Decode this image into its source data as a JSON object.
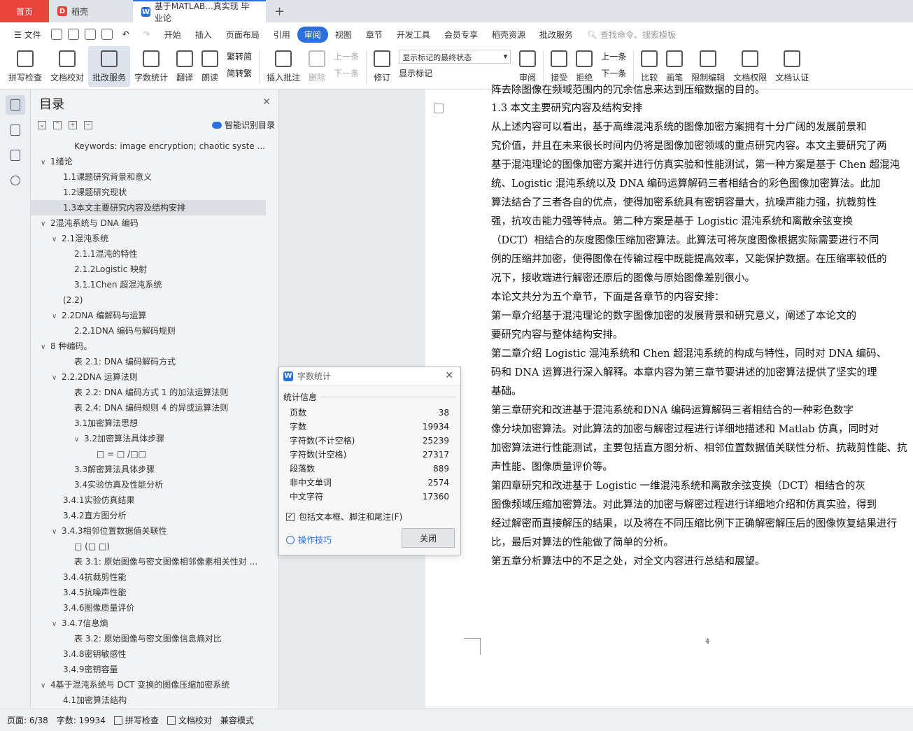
{
  "tabs": {
    "home": "首页",
    "daoke": "稻壳",
    "doc": "基于MATLAB...真实现 毕业论",
    "plus": "+"
  },
  "menu": [
    "文件",
    "开始",
    "插入",
    "页面布局",
    "引用",
    "审阅",
    "视图",
    "章节",
    "开发工具",
    "会员专享",
    "稻壳资源",
    "批改服务"
  ],
  "menu_active": "审阅",
  "search_placeholder": "查找命令、搜索模板",
  "ribbon": {
    "spell": "拼写检查",
    "doccheck": "文档校对",
    "correct": "批改服务",
    "wordcount": "字数统计",
    "translate": "翻译",
    "read": "朗读",
    "trad": "繁转简",
    "simp": "简转繁",
    "insert_comment": "插入批注",
    "delete": "删除",
    "prev": "上一条",
    "next": "下一条",
    "track": "修订",
    "show_final": "显示标记的最终状态",
    "show_marks": "显示标记",
    "review": "审阅",
    "accept": "接受",
    "reject": "拒绝",
    "prev2": "上一条",
    "next2": "下一条",
    "compare": "比较",
    "pen": "画笔",
    "restrict": "限制编辑",
    "perm": "文档权限",
    "cert": "文档认证"
  },
  "toc": {
    "title": "目录",
    "smart": "智能识别目录",
    "items": [
      {
        "t": "Keywords: image encryption; chaotic syste ...",
        "l": 3,
        "c": ""
      },
      {
        "t": "1绪论",
        "l": 1,
        "c": "v"
      },
      {
        "t": "1.1课题研究背景和意义",
        "l": 2,
        "c": ""
      },
      {
        "t": "1.2课题研究现状",
        "l": 2,
        "c": ""
      },
      {
        "t": "1.3本文主要研究内容及结构安排",
        "l": 2,
        "c": "",
        "sel": true
      },
      {
        "t": "2混沌系统与 DNA 编码",
        "l": 1,
        "c": "v"
      },
      {
        "t": "2.1混沌系统",
        "l": 2,
        "c": "v"
      },
      {
        "t": "2.1.1混沌的特性",
        "l": 3,
        "c": ""
      },
      {
        "t": "2.1.2Logistic 映射",
        "l": 3,
        "c": ""
      },
      {
        "t": "3.1.1Chen 超混沌系统",
        "l": 3,
        "c": ""
      },
      {
        "t": "(2.2)",
        "l": 2,
        "c": ""
      },
      {
        "t": "2.2DNA 编解码与运算",
        "l": 2,
        "c": "v"
      },
      {
        "t": "2.2.1DNA 编码与解码规则",
        "l": 3,
        "c": ""
      },
      {
        "t": "8 种编码。",
        "l": 1,
        "c": "v"
      },
      {
        "t": "表 2.1:  DNA 编码解码方式",
        "l": 3,
        "c": ""
      },
      {
        "t": "2.2.2DNA 运算法则",
        "l": 2,
        "c": "v"
      },
      {
        "t": "表 2.2:  DNA 编码方式 1 的加法运算法则",
        "l": 3,
        "c": ""
      },
      {
        "t": "表 2.4:  DNA 编码规则 4 的异或运算法则",
        "l": 3,
        "c": ""
      },
      {
        "t": "3.1加密算法思想",
        "l": 3,
        "c": ""
      },
      {
        "t": "3.2加密算法具体步骤",
        "l": 3,
        "c": "v"
      },
      {
        "t": "□ = □  /□□",
        "l": 4,
        "c": ""
      },
      {
        "t": "3.3解密算法具体步骤",
        "l": 3,
        "c": ""
      },
      {
        "t": "3.4实验仿真及性能分析",
        "l": 3,
        "c": ""
      },
      {
        "t": "3.4.1实验仿真结果",
        "l": 2,
        "c": ""
      },
      {
        "t": "3.4.2直方图分析",
        "l": 2,
        "c": ""
      },
      {
        "t": "3.4.3相邻位置数据值关联性",
        "l": 2,
        "c": "v"
      },
      {
        "t": "□  (□ □)",
        "l": 3,
        "c": ""
      },
      {
        "t": "表 3.1:  原始图像与密文图像相邻像素相关性对 ...",
        "l": 3,
        "c": ""
      },
      {
        "t": "3.4.4抗裁剪性能",
        "l": 2,
        "c": ""
      },
      {
        "t": "3.4.5抗噪声性能",
        "l": 2,
        "c": ""
      },
      {
        "t": "3.4.6图像质量评价",
        "l": 2,
        "c": ""
      },
      {
        "t": "3.4.7信息熵",
        "l": 2,
        "c": "v"
      },
      {
        "t": "表 3.2:  原始图像与密文图像信息熵对比",
        "l": 3,
        "c": ""
      },
      {
        "t": "3.4.8密钥敏感性",
        "l": 2,
        "c": ""
      },
      {
        "t": "3.4.9密钥容量",
        "l": 2,
        "c": ""
      },
      {
        "t": "4基于混沌系统与 DCT 变换的图像压缩加密系统",
        "l": 1,
        "c": "v"
      },
      {
        "t": "4.1加密算法结构",
        "l": 2,
        "c": ""
      }
    ]
  },
  "page": {
    "lines": [
      "阵去除图像在频域范围内的冗余信息来达到压缩数据的目的。",
      "1.3    本文主要研究内容及结构安排",
      "      从上述内容可以看出，基于高维混沌系统的图像加密方案拥有十分广阔的发展前景和",
      "究价值，并且在未来很长时间内仍将是图像加密领域的重点研究内容。本文主要研究了两",
      "基于混沌理论的图像加密方案并进行仿真实验和性能测试，第一种方案是基于 Chen 超混沌",
      "统、Logistic 混沌系统以及 DNA 编码运算解码三者相结合的彩色图像加密算法。此加",
      "算法结合了三者各自的优点，使得加密系统具有密钥容量大，抗噪声能力强，抗裁剪性",
      "强，抗攻击能力强等特点。第二种方案是基于 Logistic 混沌系统和离散余弦变换",
      "（DCT）相结合的灰度图像压缩加密算法。此算法可将灰度图像根据实际需要进行不同",
      "例的压缩并加密，使得图像在传输过程中既能提高效率，又能保护数据。在压缩率较低的",
      "况下，接收端进行解密还原后的图像与原始图像差别很小。",
      "      本论文共分为五个章节，下面是各章节的内容安排：",
      "      第一章介绍基于混沌理论的数字图像加密的发展背景和研究意义，阐述了本论文的",
      "要研究内容与整体结构安排。",
      "      第二章介绍 Logistic 混沌系统和 Chen 超混沌系统的构成与特性，同时对 DNA 编码、",
      "码和 DNA 运算进行深入解释。本章内容为第三章节要讲述的加密算法提供了坚实的理",
      "基础。",
      "      第三章研究和改进基于混沌系统和DNA 编码运算解码三者相结合的一种彩色数字",
      "像分块加密算法。对此算法的加密与解密过程进行详细地描述和 Matlab 仿真，同时对",
      "加密算法进行性能测试，主要包括直方图分析、相邻位置数据值关联性分析、抗裁剪性能、抗",
      "声性能、图像质量评价等。",
      "      第四章研究和改进基于 Logistic 一维混沌系统和离散余弦变换（DCT）相结合的灰",
      "图像频域压缩加密算法。对此算法的加密与解密过程进行详细地介绍和仿真实验，得到",
      "经过解密而直接解压的结果，以及将在不同压缩比例下正确解密解压后的图像恢复结果进行",
      "比，最后对算法的性能做了简单的分析。",
      "      第五章分析算法中的不足之处，对全文内容进行总结和展望。"
    ],
    "page_number": "4"
  },
  "dialog": {
    "title": "字数统计",
    "section": "统计信息",
    "stats": [
      {
        "k": "页数",
        "v": "38"
      },
      {
        "k": "字数",
        "v": "19934"
      },
      {
        "k": "字符数(不计空格)",
        "v": "25239"
      },
      {
        "k": "字符数(计空格)",
        "v": "27317"
      },
      {
        "k": "段落数",
        "v": "889"
      },
      {
        "k": "非中文单词",
        "v": "2574"
      },
      {
        "k": "中文字符",
        "v": "17360"
      }
    ],
    "checkbox": "包括文本框、脚注和尾注(F)",
    "tips": "操作技巧",
    "close": "关闭"
  },
  "status": {
    "page": "页面: 6/38",
    "words": "字数: 19934",
    "spell": "拼写检查",
    "check": "文档校对",
    "compat": "兼容模式"
  }
}
